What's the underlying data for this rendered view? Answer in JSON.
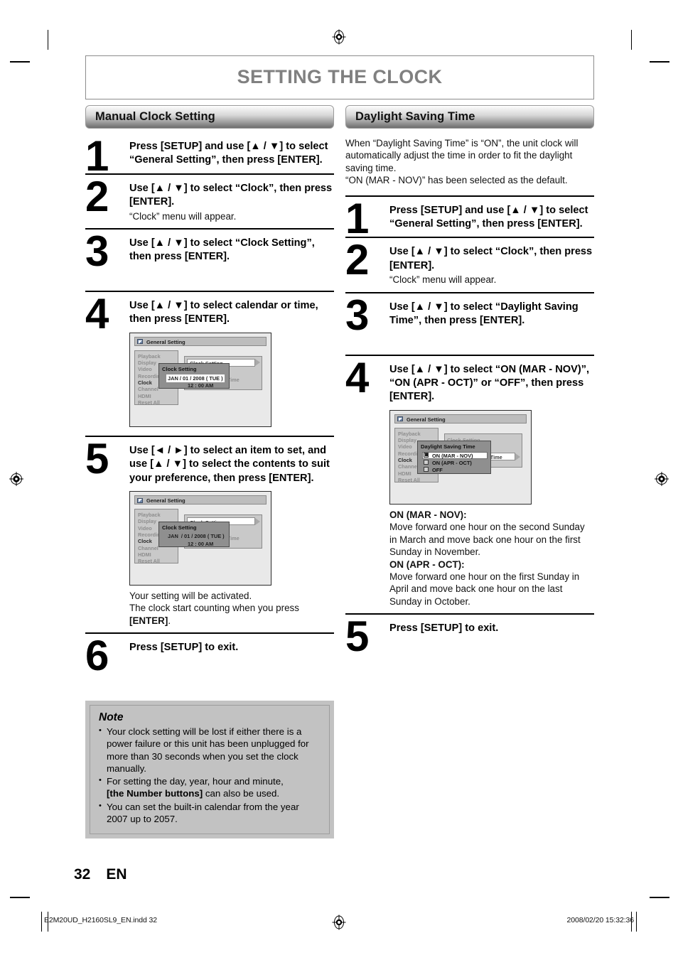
{
  "page": {
    "title": "SETTING THE CLOCK",
    "number": "32",
    "lang": "EN"
  },
  "footer": {
    "file": "E2M20UD_H2160SL9_EN.indd   32",
    "timestamp": "2008/02/20   15:32:36"
  },
  "left_column": {
    "section_title": "Manual Clock Setting",
    "steps": [
      {
        "num": "1",
        "title": "Press [SETUP] and use [▲ / ▼] to select “General Setting”, then press [ENTER]."
      },
      {
        "num": "2",
        "title": "Use [▲ / ▼] to select “Clock”, then press [ENTER].",
        "sub": "“Clock” menu will appear."
      },
      {
        "num": "3",
        "title": "Use [▲ / ▼] to select “Clock Setting”, then press [ENTER]."
      },
      {
        "num": "4",
        "title": "Use [▲ / ▼] to select calendar or time, then press [ENTER]."
      },
      {
        "num": "5",
        "title": "Use [◄ / ►] to select an item to set, and use [▲ / ▼] to select the contents to suit your preference, then press [ENTER].",
        "after_line1": "Your setting will be activated.",
        "after_line2": "The clock start counting when you press",
        "after_bold": "[ENTER]",
        "after_end": "."
      },
      {
        "num": "6",
        "title": "Press [SETUP] to exit."
      }
    ],
    "note": {
      "heading": "Note",
      "items": [
        {
          "text": "Your clock setting will be lost if either there is a power failure or this unit has been unplugged for more than 30 seconds when you set the clock manually."
        },
        {
          "text_before": "For setting the day, year, hour and minute,",
          "bold": "[the Number buttons]",
          "text_after": " can also be used."
        },
        {
          "text": "You can set the built-in calendar from the year 2007 up to 2057."
        }
      ]
    }
  },
  "right_column": {
    "section_title": "Daylight Saving Time",
    "intro": "When “Daylight Saving Time” is “ON”, the unit clock will automatically adjust the time in order to fit the daylight saving time.\n“ON (MAR - NOV)” has been selected as the default.",
    "steps": [
      {
        "num": "1",
        "title": "Press [SETUP] and use [▲ / ▼] to select “General Setting”, then press [ENTER]."
      },
      {
        "num": "2",
        "title": "Use [▲ / ▼] to select “Clock”, then press [ENTER].",
        "sub": "“Clock” menu will appear."
      },
      {
        "num": "3",
        "title": "Use [▲ / ▼] to select “Daylight Saving Time”, then press [ENTER]."
      },
      {
        "num": "4",
        "title": "Use [▲ / ▼] to select “ON (MAR - NOV)”, “ON (APR - OCT)” or “OFF”, then press [ENTER]."
      },
      {
        "num": "5",
        "title": "Press [SETUP] to exit."
      }
    ],
    "definitions": [
      {
        "term": "ON (MAR - NOV):",
        "desc": "Move forward one hour on the second Sunday in March and move back one hour on the first Sunday in November."
      },
      {
        "term": "ON (APR - OCT):",
        "desc": "Move forward one hour on the first Sunday in April and move back one hour on the last Sunday in October."
      }
    ]
  },
  "osd": {
    "window_title": "General Setting",
    "side_menu": [
      "Playback",
      "Display",
      "Video",
      "Recording",
      "Clock",
      "Channel",
      "HDMI",
      "Reset All"
    ],
    "side_menu_selected": "Clock",
    "clock_panel": {
      "highlight": "Clock Setting",
      "row2": "Clock Setting",
      "row3": "Daylight Saving Time"
    },
    "dlg_clock": {
      "title": "Clock Setting",
      "date": "JAN / 01 / 2008 ( TUE )",
      "date_month": "JAN",
      "date_rest": " / 01 / 2008 ( TUE )",
      "time": "12 : 00 AM"
    },
    "dlg_dst": {
      "title": "Daylight Saving Time",
      "options": [
        {
          "label": "ON (MAR - NOV)",
          "checked": true
        },
        {
          "label": "ON (APR - OCT)",
          "checked": false
        },
        {
          "label": "OFF",
          "checked": false
        }
      ]
    }
  }
}
